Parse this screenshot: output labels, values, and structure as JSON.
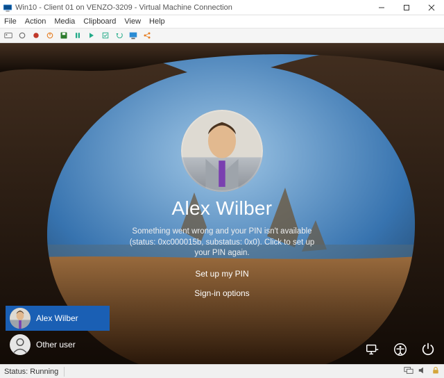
{
  "window": {
    "title": "Win10 - Client 01 on VENZO-3209 - Virtual Machine Connection"
  },
  "menus": {
    "file": "File",
    "action": "Action",
    "media": "Media",
    "clipboard": "Clipboard",
    "view": "View",
    "help": "Help"
  },
  "logon": {
    "display_name": "Alex Wilber",
    "error_message": "Something went wrong and your PIN isn't available (status: 0xc000015b, substatus: 0x0). Click to set up your PIN again.",
    "setup_pin": "Set up my PIN",
    "signin_options": "Sign-in options"
  },
  "users": [
    {
      "name": "Alex Wilber",
      "selected": true,
      "avatar": "alex"
    },
    {
      "name": "Other user",
      "selected": false,
      "avatar": "generic"
    }
  ],
  "status": {
    "text": "Status: Running"
  }
}
